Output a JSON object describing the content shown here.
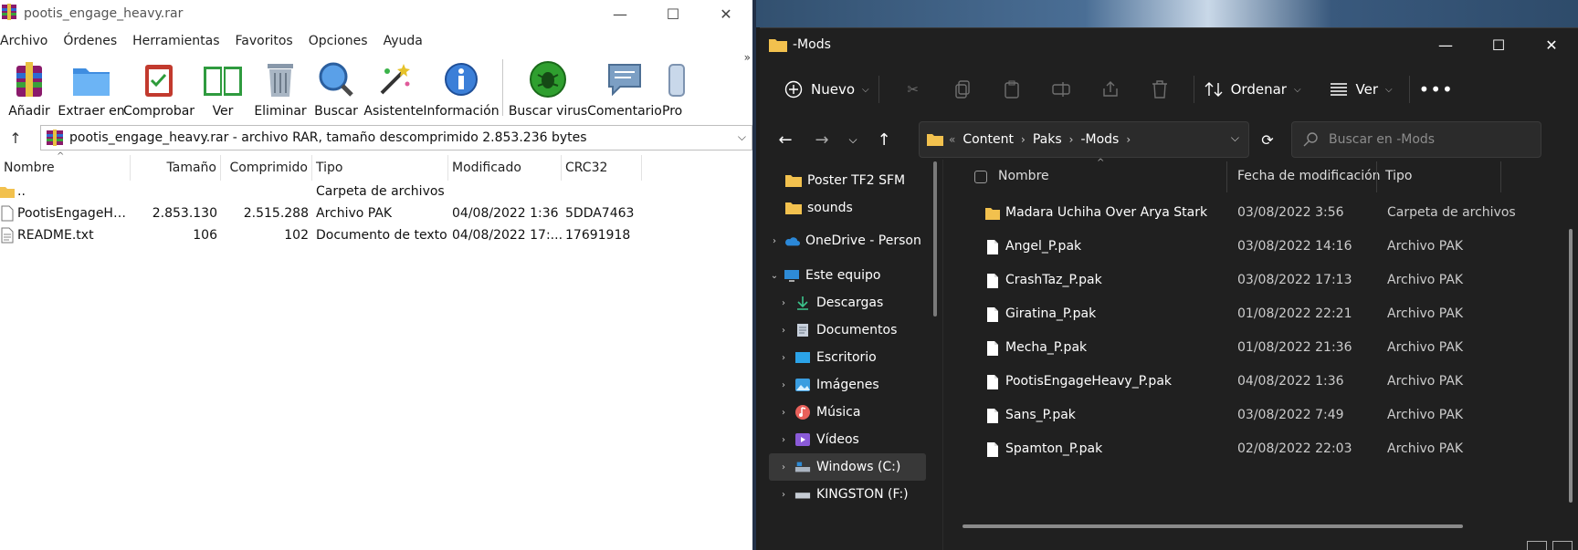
{
  "winrar": {
    "title": "pootis_engage_heavy.rar",
    "menu": [
      "Archivo",
      "Órdenes",
      "Herramientas",
      "Favoritos",
      "Opciones",
      "Ayuda"
    ],
    "toolbar": [
      {
        "label": "Añadir",
        "icon": "add-books-icon"
      },
      {
        "label": "Extraer en",
        "icon": "extract-folder-icon"
      },
      {
        "label": "Comprobar",
        "icon": "test-clipboard-icon"
      },
      {
        "label": "Ver",
        "icon": "view-book-icon"
      },
      {
        "label": "Eliminar",
        "icon": "trash-icon"
      },
      {
        "label": "Buscar",
        "icon": "magnifier-icon"
      },
      {
        "label": "Asistente",
        "icon": "wizard-wand-icon"
      },
      {
        "label": "Información",
        "icon": "info-icon"
      },
      {
        "label": "Buscar virus",
        "icon": "virus-scan-icon"
      },
      {
        "label": "Comentario",
        "icon": "comment-icon"
      },
      {
        "label": "Pro",
        "icon": "protect-icon"
      }
    ],
    "address": "pootis_engage_heavy.rar - archivo RAR, tamaño descomprimido 2.853.236 bytes",
    "columns": [
      "Nombre",
      "Tamaño",
      "Comprimido",
      "Tipo",
      "Modificado",
      "CRC32"
    ],
    "rows": [
      {
        "name": "..",
        "size": "",
        "packed": "",
        "type": "Carpeta de archivos",
        "modified": "",
        "crc": "",
        "icon": "folder-icon"
      },
      {
        "name": "PootisEngageHe...",
        "size": "2.853.130",
        "packed": "2.515.288",
        "type": "Archivo PAK",
        "modified": "04/08/2022 1:36",
        "crc": "5DDA7463",
        "icon": "file-icon"
      },
      {
        "name": "README.txt",
        "size": "106",
        "packed": "102",
        "type": "Documento de texto",
        "modified": "04/08/2022 17:...",
        "crc": "17691918",
        "icon": "text-file-icon"
      }
    ]
  },
  "explorer": {
    "title": "-Mods",
    "cmd": {
      "new": "Nuevo",
      "sort": "Ordenar",
      "view": "Ver"
    },
    "path": [
      "Content",
      "Paks",
      "-Mods"
    ],
    "search_placeholder": "Buscar en -Mods",
    "nav": [
      {
        "label": "Poster TF2 SFM",
        "icon": "folder-icon",
        "expandable": false
      },
      {
        "label": "sounds",
        "icon": "folder-icon",
        "expandable": false
      },
      {
        "label": "OneDrive - Person",
        "icon": "onedrive-cloud-icon",
        "expandable": true
      },
      {
        "label": "Este equipo",
        "icon": "computer-icon",
        "expandable": true
      },
      {
        "label": "Descargas",
        "icon": "download-icon",
        "expandable": true
      },
      {
        "label": "Documentos",
        "icon": "documents-icon",
        "expandable": true
      },
      {
        "label": "Escritorio",
        "icon": "desktop-icon",
        "expandable": true
      },
      {
        "label": "Imágenes",
        "icon": "pictures-icon",
        "expandable": true
      },
      {
        "label": "Música",
        "icon": "music-icon",
        "expandable": true
      },
      {
        "label": "Vídeos",
        "icon": "videos-icon",
        "expandable": true
      },
      {
        "label": "Windows (C:)",
        "icon": "drive-icon",
        "expandable": true
      },
      {
        "label": "KINGSTON (F:)",
        "icon": "usb-drive-icon",
        "expandable": true
      }
    ],
    "columns": [
      "Nombre",
      "Fecha de modificación",
      "Tipo"
    ],
    "rows": [
      {
        "name": "Madara Uchiha Over Arya Stark",
        "date": "03/08/2022 3:56",
        "type": "Carpeta de archivos",
        "icon": "folder-icon"
      },
      {
        "name": "Angel_P.pak",
        "date": "03/08/2022 14:16",
        "type": "Archivo PAK",
        "icon": "file-icon"
      },
      {
        "name": "CrashTaz_P.pak",
        "date": "03/08/2022 17:13",
        "type": "Archivo PAK",
        "icon": "file-icon"
      },
      {
        "name": "Giratina_P.pak",
        "date": "01/08/2022 22:21",
        "type": "Archivo PAK",
        "icon": "file-icon"
      },
      {
        "name": "Mecha_P.pak",
        "date": "01/08/2022 21:36",
        "type": "Archivo PAK",
        "icon": "file-icon"
      },
      {
        "name": "PootisEngageHeavy_P.pak",
        "date": "04/08/2022 1:36",
        "type": "Archivo PAK",
        "icon": "file-icon"
      },
      {
        "name": "Sans_P.pak",
        "date": "03/08/2022 7:49",
        "type": "Archivo PAK",
        "icon": "file-icon"
      },
      {
        "name": "Spamton_P.pak",
        "date": "02/08/2022 22:03",
        "type": "Archivo PAK",
        "icon": "file-icon"
      }
    ]
  },
  "colors": {
    "explorer_bg": "#202020",
    "folder": "#f2c14e",
    "winrar_bg": "#ffffff"
  }
}
